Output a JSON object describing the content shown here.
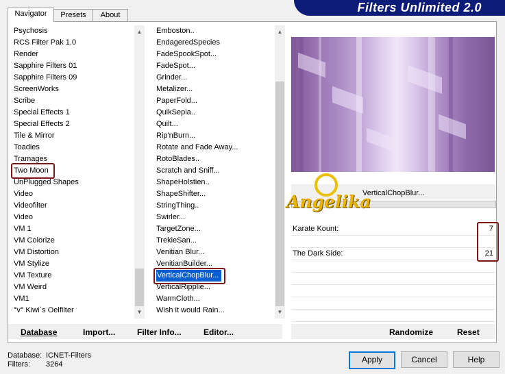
{
  "title": "Filters Unlimited 2.0",
  "tabs": [
    {
      "label": "Navigator",
      "active": true
    },
    {
      "label": "Presets",
      "active": false
    },
    {
      "label": "About",
      "active": false
    }
  ],
  "categories": [
    "Psychosis",
    "RCS Filter Pak 1.0",
    "Render",
    "Sapphire Filters 01",
    "Sapphire Filters 09",
    "ScreenWorks",
    "Scribe",
    "Special Effects 1",
    "Special Effects 2",
    "Tile & Mirror",
    "Toadies",
    "Tramages",
    "Two Moon",
    "UnPlugged Shapes",
    "Video",
    "Videofilter",
    "Video",
    "VM 1",
    "VM Colorize",
    "VM Distortion",
    "VM Stylize",
    "VM Texture",
    "VM Weird",
    "VM1",
    "°v° Kiwi`s Oelfilter"
  ],
  "highlighted_category": "Two Moon",
  "filters": [
    "Emboston..",
    "EndageredSpecies",
    "FadeSpookSpot...",
    "FadeSpot...",
    "Grinder...",
    "Metalizer...",
    "PaperFold...",
    "QuikSepia..",
    "Quilt...",
    "Rip'nBurn...",
    "Rotate and Fade Away...",
    "RotoBlades..",
    "Scratch and Sniff...",
    "ShapeHolstien..",
    "ShapeShifter...",
    "StringThing..",
    "Swirler...",
    "TargetZone...",
    "TrekieSan...",
    "Venitian Blur...",
    "VenitianBuilder...",
    "VerticalChopBlur...",
    "VerticalRipplie...",
    "WarmCloth...",
    "Wish it would Rain..."
  ],
  "selected_filter": "VerticalChopBlur...",
  "filter_name_label": "VerticalChopBlur...",
  "watermark": "Angelika",
  "params": [
    {
      "label": "Karate Kount:",
      "value": "7"
    },
    {
      "label": "The Dark Side:",
      "value": "21"
    }
  ],
  "bottom_buttons": {
    "database": "Database",
    "import": "Import...",
    "filter_info": "Filter Info...",
    "editor": "Editor...",
    "randomize": "Randomize",
    "reset": "Reset"
  },
  "status": {
    "database_label": "Database:",
    "database_value": "ICNET-Filters",
    "filters_label": "Filters:",
    "filters_value": "3264"
  },
  "dialog_buttons": {
    "apply": "Apply",
    "cancel": "Cancel",
    "help": "Help"
  },
  "colors": {
    "title_bg": "#0c1a78",
    "selection": "#0a5fd0",
    "highlight_border": "#7a1515",
    "preview_tint": "#9a73b3"
  }
}
